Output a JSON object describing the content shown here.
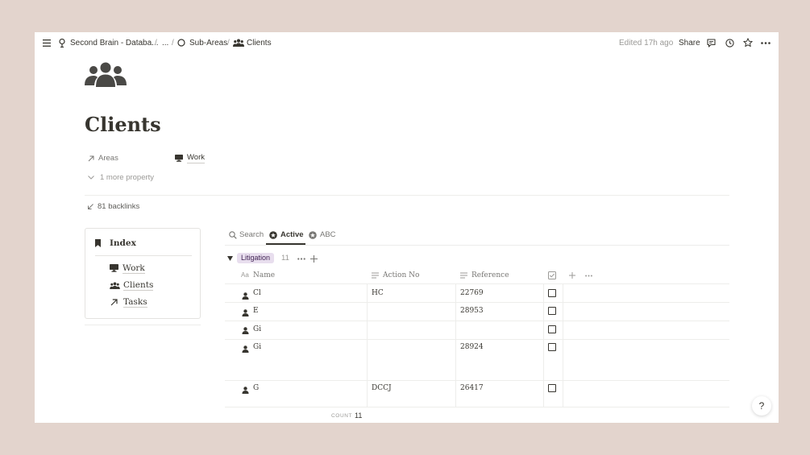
{
  "topbar": {
    "breadcrumbs": [
      "Second Brain - Databa...",
      "...",
      "Sub-Areas",
      "Clients"
    ],
    "separators": [
      "/",
      "/",
      "/"
    ],
    "edited": "Edited 17h ago",
    "share": "Share"
  },
  "page": {
    "icon": "people-group-icon",
    "title": "Clients",
    "properties": [
      {
        "name": "Areas",
        "value": "Work"
      }
    ],
    "more_property": "1 more property",
    "backlinks": "81 backlinks"
  },
  "index": {
    "title": "Index",
    "items": [
      {
        "label": "Work",
        "icon": "computer-icon"
      },
      {
        "label": "Clients",
        "icon": "people-group-icon"
      },
      {
        "label": "Tasks",
        "icon": "arrow-up-right-icon"
      }
    ]
  },
  "views": {
    "tabs": [
      "Search",
      "Active",
      "ABC"
    ],
    "active_tab": "Active"
  },
  "group": {
    "label": "Litigation",
    "count": "11"
  },
  "table": {
    "columns": {
      "name_prefix": "Aa",
      "name": "Name",
      "action_no": "Action No",
      "reference": "Reference"
    },
    "rows": [
      {
        "name": "Cl",
        "action_no": "HC",
        "reference": "22769",
        "checked": false
      },
      {
        "name": "E",
        "action_no": "",
        "reference": "28953",
        "checked": false
      },
      {
        "name": "Gi",
        "action_no": "",
        "reference": "",
        "checked": false
      },
      {
        "name": "Gi",
        "action_no": "",
        "reference": "28924",
        "checked": false
      },
      {
        "name": "G",
        "action_no": "DCCJ",
        "reference": "26417",
        "checked": false
      }
    ],
    "footer_label": "COUNT",
    "footer_value": "11"
  },
  "help": "?"
}
